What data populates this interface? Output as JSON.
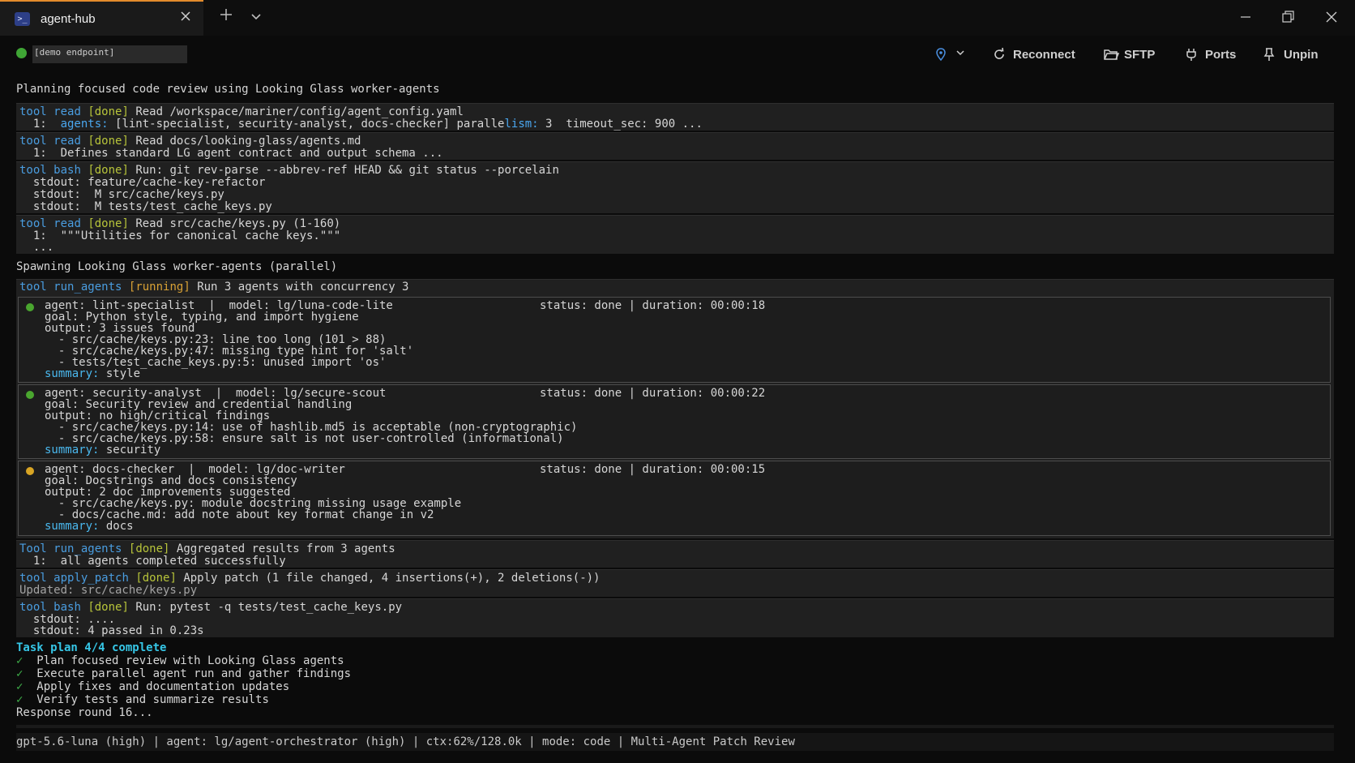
{
  "tab": {
    "icon": "terminal-icon",
    "title": "agent-hub"
  },
  "toolbar": {
    "endpoint": "[demo endpoint]",
    "reconnect": "Reconnect",
    "sftp": "SFTP",
    "ports": "Ports",
    "unpin": "Unpin"
  },
  "colors": {
    "accent": "#e38b2c",
    "status_ok": "#3fa535",
    "status_warn": "#d9a524",
    "tool_keyword": "#4a9de0",
    "done": "#b7c43a"
  },
  "transcript": {
    "heading1": "Planning focused code review using Looking Glass worker-agents",
    "b1": {
      "t": "tool",
      "n": "read",
      "s": "[done]",
      "text": "Read /workspace/mariner/config/agent_config.yaml",
      "l1_pre": "  1:  ",
      "l1_key": "agents:",
      "l1_mid": " [lint-specialist, security-analyst, docs-checker] paralle",
      "l1_key2": "lism:",
      "l1_post": " 3  timeout_sec: 900 ..."
    },
    "b2": {
      "t": "tool",
      "n": "read",
      "s": "[done]",
      "text": "Read docs/looking-glass/agents.md",
      "l1": "  1:  Defines standard LG agent contract and output schema ..."
    },
    "b3": {
      "t": "tool",
      "n": "bash",
      "s": "[done]",
      "text": "Run: git rev-parse --abbrev-ref HEAD && git status --porcelain",
      "l1": "  stdout: feature/cache-key-refactor",
      "l2": "  stdout:  M src/cache/keys.py",
      "l3": "  stdout:  M tests/test_cache_keys.py"
    },
    "b4": {
      "t": "tool",
      "n": "read",
      "s": "[done]",
      "text": "Read src/cache/keys.py (1-160)",
      "l1": "  1:  \"\"\"Utilities for canonical cache keys.\"\"\"",
      "l2": "  ..."
    },
    "heading2": "Spawning Looking Glass worker-agents (parallel)",
    "b5": {
      "t": "tool",
      "n": "run_agents",
      "s": "[running]",
      "text": "Run 3 agents with concurrency 3"
    },
    "agents": [
      {
        "head": "agent: lint-specialist  |  model: lg/luna-code-lite",
        "status": "status: done | duration: 00:00:18",
        "goal": "goal: Python style, typing, and import hygiene",
        "output": "output: 3 issues found",
        "items": [
          "  - src/cache/keys.py:23: line too long (101 > 88)",
          "  - src/cache/keys.py:47: missing type hint for 'salt'",
          "  - tests/test_cache_keys.py:5: unused import 'os'"
        ],
        "sum_key": "summary:",
        "sum_val": " style"
      },
      {
        "head": "agent: security-analyst  |  model: lg/secure-scout",
        "status": "status: done | duration: 00:00:22",
        "goal": "goal: Security review and credential handling",
        "output": "output: no high/critical findings",
        "items": [
          "  - src/cache/keys.py:14: use of hashlib.md5 is acceptable (non-cryptographic)",
          "  - src/cache/keys.py:58: ensure salt is not user-controlled (informational)"
        ],
        "sum_key": "summary:",
        "sum_val": " security"
      },
      {
        "head": "agent: docs-checker  |  model: lg/doc-writer",
        "status": "status: done | duration: 00:00:15",
        "goal": "goal: Docstrings and docs consistency",
        "output": "output: 2 doc improvements suggested",
        "items": [
          "  - src/cache/keys.py: module docstring missing usage example",
          "  - docs/cache.md: add note about key format change in v2"
        ],
        "sum_key": "summary:",
        "sum_val": " docs"
      }
    ],
    "b6": {
      "t": "Tool",
      "n": "run_agents",
      "s": "[done]",
      "text": "Aggregated results from 3 agents",
      "l1": "  1:  all agents completed successfully"
    },
    "b7": {
      "t": "tool",
      "n": "apply_patch",
      "s": "[done]",
      "text": "Apply patch (1 file changed, 4 insertions(+), 2 deletions(-))",
      "l1": "Updated: src/cache/keys.py"
    },
    "b8": {
      "t": "tool",
      "n": "bash",
      "s": "[done]",
      "text": "Run: pytest -q tests/test_cache_keys.py",
      "l1": "  stdout: ....",
      "l2": "  stdout: 4 passed in 0.23s"
    },
    "plan_title": "Task plan 4/4 complete",
    "plan": [
      "Plan focused review with Looking Glass agents",
      "Execute parallel agent run and gather findings",
      "Apply fixes and documentation updates",
      "Verify tests and summarize results"
    ],
    "check_glyph": "✓",
    "response": "Response round 16..."
  },
  "statusbar": "gpt-5.6-luna (high) | agent: lg/agent-orchestrator (high) | ctx:62%/128.0k | mode: code | Multi-Agent Patch Review"
}
